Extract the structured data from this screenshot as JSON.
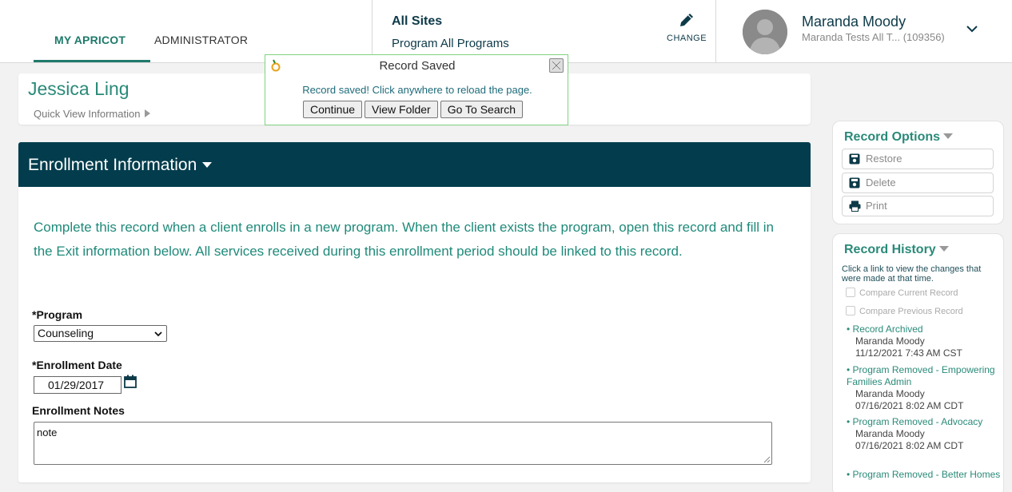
{
  "header": {
    "tabs": [
      {
        "label": "MY APRICOT",
        "active": true
      },
      {
        "label": "ADMINISTRATOR",
        "active": false
      }
    ],
    "site": {
      "title": "All Sites",
      "program": "Program All Programs"
    },
    "change_label": "CHANGE",
    "user": {
      "name": "Maranda Moody",
      "org": "Maranda Tests All T...",
      "id": "(109356)"
    }
  },
  "client": {
    "name": "Jessica Ling",
    "quick_view": "Quick View Information"
  },
  "dialog": {
    "title": "Record Saved",
    "message": "Record saved! Click anywhere to reload the page.",
    "buttons": [
      "Continue",
      "View Folder",
      "Go To Search"
    ]
  },
  "panel": {
    "title": "Enrollment Information",
    "intro": "Complete this record when a client enrolls in a new program. When the client exists the program, open this record and fill in the Exit information below. All services received during this enrollment period should be linked to this record.",
    "program_label": "*Program",
    "program_value": "Counseling",
    "date_label": "*Enrollment Date",
    "date_value": "01/29/2017",
    "notes_label": "Enrollment Notes",
    "notes_value": "note"
  },
  "record_options": {
    "title": "Record Options",
    "buttons": [
      {
        "label": "Restore",
        "icon": "save-icon"
      },
      {
        "label": "Delete",
        "icon": "save-icon"
      },
      {
        "label": "Print",
        "icon": "print-icon"
      }
    ]
  },
  "record_history": {
    "title": "Record History",
    "hint": "Click a link to view the changes that were made at that time.",
    "compare_current": "Compare Current Record",
    "compare_previous": "Compare Previous Record",
    "entries": [
      {
        "link": "• Record Archived",
        "user": "Maranda Moody",
        "time": "11/12/2021 7:43 AM CST"
      },
      {
        "link": "• Program Removed - Empowering Families Admin",
        "user": "Maranda Moody",
        "time": "07/16/2021 8:02 AM CDT"
      },
      {
        "link": "• Program Removed - Advocacy",
        "user": "Maranda Moody",
        "time": "07/16/2021 8:02 AM CDT"
      },
      {
        "link": "• Program Removed - Better Homes",
        "user": "",
        "time": ""
      }
    ]
  },
  "colors": {
    "accent": "#2a8a79",
    "header_dark": "#033d4d",
    "dialog_border": "#7fd37f"
  }
}
